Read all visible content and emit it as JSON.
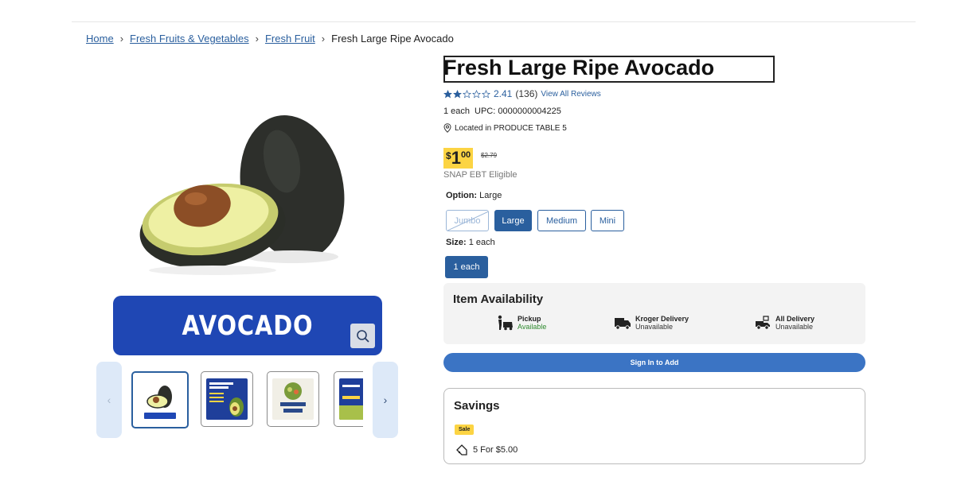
{
  "breadcrumb": {
    "items": [
      "Home",
      "Fresh Fruits & Vegetables",
      "Fresh Fruit"
    ],
    "current": "Fresh Large Ripe Avocado"
  },
  "gallery": {
    "banner_text": "AVOCADO",
    "thumbnails": [
      "avocado",
      "nutrient-rich",
      "bowl",
      "diced"
    ]
  },
  "product": {
    "title": "Fresh Large Ripe Avocado",
    "rating_value": "2.41",
    "rating_stars": 2.41,
    "review_count": "(136)",
    "view_reviews": "View All Reviews",
    "unit": "1 each",
    "upc": "UPC: 0000000004225",
    "location": "Located in PRODUCE TABLE 5"
  },
  "price": {
    "dollar_sign": "$",
    "whole": "1",
    "cents": "00",
    "original": "$2.79",
    "snap": "SNAP EBT Eligible"
  },
  "option": {
    "label": "Option:",
    "selected": "Large",
    "choices": [
      "Jumbo",
      "Large",
      "Medium",
      "Mini"
    ]
  },
  "size": {
    "label": "Size:",
    "selected": "1 each",
    "button": "1 each"
  },
  "availability": {
    "title": "Item Availability",
    "items": [
      {
        "name": "Pickup",
        "status": "Available"
      },
      {
        "name": "Kroger Delivery",
        "status": "Unavailable"
      },
      {
        "name": "All Delivery",
        "status": "Unavailable"
      }
    ]
  },
  "cta": {
    "sign_in": "Sign In to Add"
  },
  "savings": {
    "title": "Savings",
    "badge": "Sale",
    "deal": "5 For $5.00"
  },
  "colors": {
    "brand_blue": "#2a5f9e",
    "price_yellow": "#fcd443",
    "banner_blue": "#1f47b4",
    "available_green": "#2f8a2f"
  }
}
